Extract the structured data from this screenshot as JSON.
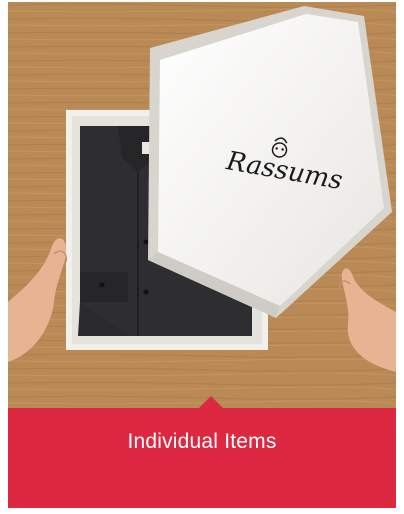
{
  "card": {
    "caption": "Individual Items",
    "accent_color": "#dc2840",
    "image": {
      "brand_logo_text": "Rassums",
      "subject_icon": "shirt-in-gift-box-icon"
    }
  }
}
